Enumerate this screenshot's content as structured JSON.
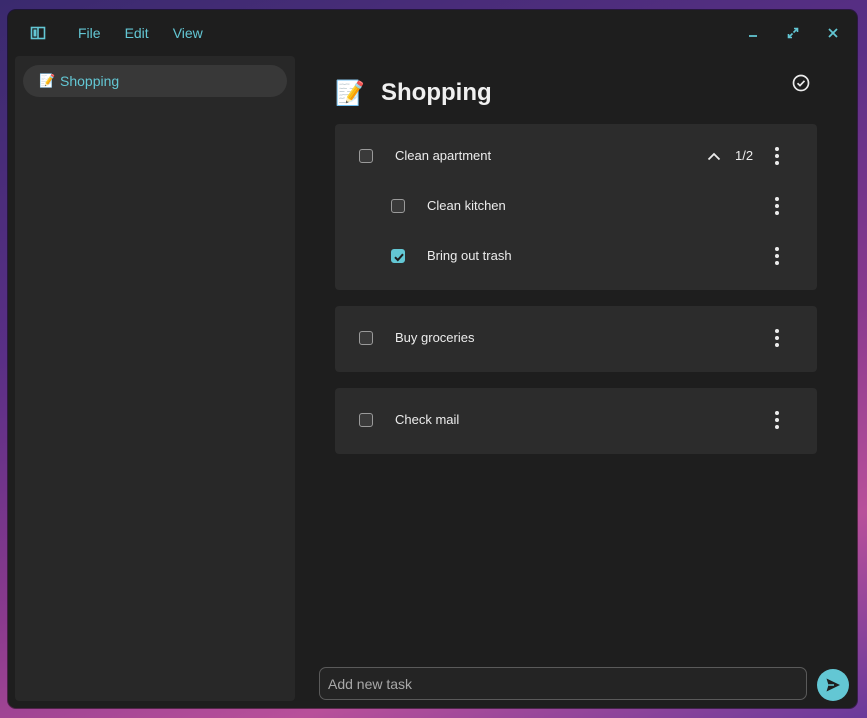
{
  "window": {
    "menu": [
      {
        "label": "File"
      },
      {
        "label": "Edit"
      },
      {
        "label": "View"
      }
    ]
  },
  "sidebar": {
    "items": [
      {
        "emoji": "📝",
        "label": "Shopping"
      }
    ]
  },
  "main": {
    "emoji": "📝",
    "title": "Shopping",
    "tasks": [
      {
        "label": "Clean apartment",
        "checked": false,
        "expanded": true,
        "progress": "1/2",
        "subtasks": [
          {
            "label": "Clean kitchen",
            "checked": false
          },
          {
            "label": "Bring out trash",
            "checked": true
          }
        ]
      },
      {
        "label": "Buy groceries",
        "checked": false
      },
      {
        "label": "Check mail",
        "checked": false
      }
    ]
  },
  "input": {
    "placeholder": "Add new task"
  },
  "colors": {
    "accent": "#63c7d4",
    "window_bg": "#1e1e1e",
    "card_bg": "#2c2c2c"
  }
}
